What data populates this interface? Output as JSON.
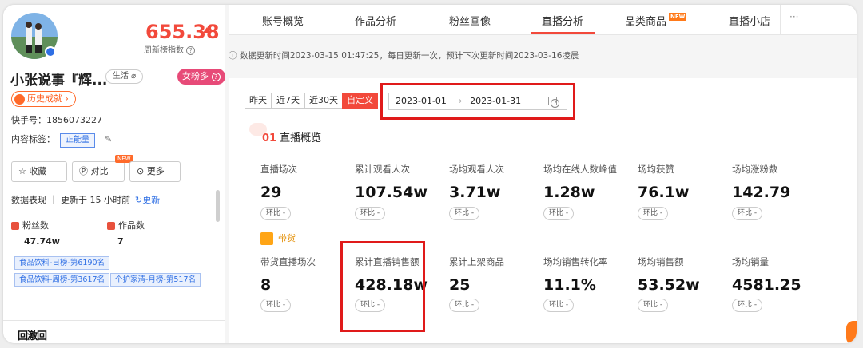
{
  "profile": {
    "score": "655.38",
    "score_label": "周新榜指数",
    "name": "小张说事『辉...",
    "category_tag": "生活 ⌀",
    "audience_tag": "女粉多",
    "history_button": "历史成就 ›",
    "ks_id": "快手号：1856073227",
    "content_tag_label": "内容标签：",
    "content_tag": "正能量",
    "actions": {
      "favorite": "☆ 收藏",
      "compare": "对比",
      "compare_badge": "NEW",
      "more": "更多"
    },
    "data_status": "数据表现 ｜ 更新于 15 小时前",
    "refresh": "更新",
    "fans_label": "粉丝数",
    "fans_value": "47.74w",
    "works_label": "作品数",
    "works_value": "7",
    "rank_tags": [
      "食品饮料-日榜-第6190名",
      "食品饮料-周榜-第3617名",
      "个护家清-月榜-第517名"
    ],
    "qr_text": "回激回"
  },
  "tabs": [
    {
      "label": "账号概览"
    },
    {
      "label": "作品分析"
    },
    {
      "label": "粉丝画像"
    },
    {
      "label": "直播分析"
    },
    {
      "label": "品类商品",
      "badge": "NEW"
    },
    {
      "label": "直播小店"
    }
  ],
  "tab_more": "···",
  "notice": "ⓘ 数据更新时间2023-03-15 01:47:25，每日更新一次，预计下次更新时间2023-03-16凌晨",
  "date_range": {
    "buttons": [
      "昨天",
      "近7天",
      "近30天",
      "自定义"
    ],
    "active": "自定义",
    "start": "2023-01-01",
    "end": "2023-01-31",
    "arrow": "→"
  },
  "overview": {
    "section_num": "01",
    "section_title": "直播概览",
    "compare_label": "环比 -",
    "row1": [
      {
        "label": "直播场次",
        "value": "29"
      },
      {
        "label": "累计观看人次",
        "value": "107.54w"
      },
      {
        "label": "场均观看人次",
        "value": "3.71w"
      },
      {
        "label": "场均在线人数峰值",
        "value": "1.28w"
      },
      {
        "label": "场均获赞",
        "value": "76.1w"
      },
      {
        "label": "场均涨粉数",
        "value": "142.79"
      }
    ],
    "goods_label": "带货",
    "row2": [
      {
        "label": "带货直播场次",
        "value": "8"
      },
      {
        "label": "累计直播销售额",
        "value": "428.18w"
      },
      {
        "label": "累计上架商品",
        "value": "25"
      },
      {
        "label": "场均销售转化率",
        "value": "11.1%"
      },
      {
        "label": "场均销售额",
        "value": "53.52w"
      },
      {
        "label": "场均销量",
        "value": "4581.25"
      }
    ]
  },
  "colors": {
    "accent": "#f2493b",
    "link": "#2f6fe4",
    "highlight_box": "#e01a1a"
  }
}
